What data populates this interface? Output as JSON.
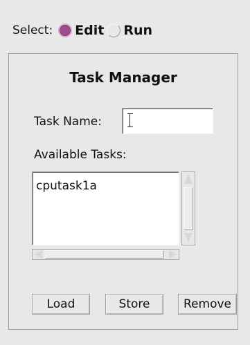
{
  "select": {
    "label": "Select:",
    "options": [
      {
        "label": "Edit",
        "selected": true
      },
      {
        "label": "Run",
        "selected": false
      }
    ]
  },
  "panel": {
    "title": "Task Manager",
    "task_name_label": "Task Name:",
    "task_name_value": "",
    "available_label": "Available Tasks:",
    "tasks": [
      "cputask1a"
    ]
  },
  "buttons": {
    "load": "Load",
    "store": "Store",
    "remove": "Remove"
  },
  "colors": {
    "radio_selected": "#9a4d8c",
    "background": "#e8e8e8"
  }
}
